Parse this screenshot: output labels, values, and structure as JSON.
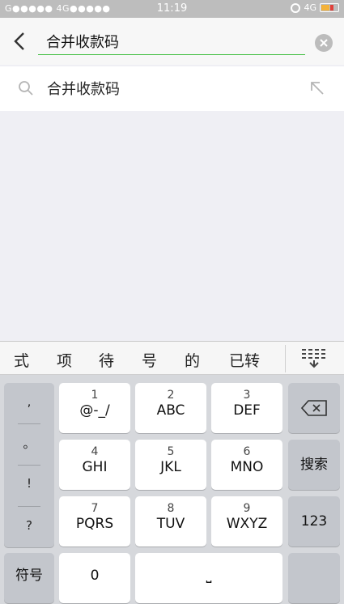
{
  "status_bar": {
    "carrier_left": "G●●●●● 4G●●●●●",
    "time": "11:19",
    "network": "4G"
  },
  "search": {
    "value": "合并收款码",
    "accent_color": "#45c045"
  },
  "suggestion": {
    "text": "合并收款码"
  },
  "candidates": [
    "式",
    "项",
    "待",
    "号",
    "的",
    "已转"
  ],
  "keyboard": {
    "punctuation": [
      ",",
      "。",
      "!",
      "?"
    ],
    "rows": [
      [
        {
          "num": "1",
          "letters": "@-_/"
        },
        {
          "num": "2",
          "letters": "ABC"
        },
        {
          "num": "3",
          "letters": "DEF"
        }
      ],
      [
        {
          "num": "4",
          "letters": "GHI"
        },
        {
          "num": "5",
          "letters": "JKL"
        },
        {
          "num": "6",
          "letters": "MNO"
        }
      ],
      [
        {
          "num": "7",
          "letters": "PQRS"
        },
        {
          "num": "8",
          "letters": "TUV"
        },
        {
          "num": "9",
          "letters": "WXYZ"
        }
      ]
    ],
    "search_label": "搜索",
    "num_mode_label": "123",
    "symbol_label": "符号",
    "zero_label": "0",
    "space_label": "⎵"
  }
}
